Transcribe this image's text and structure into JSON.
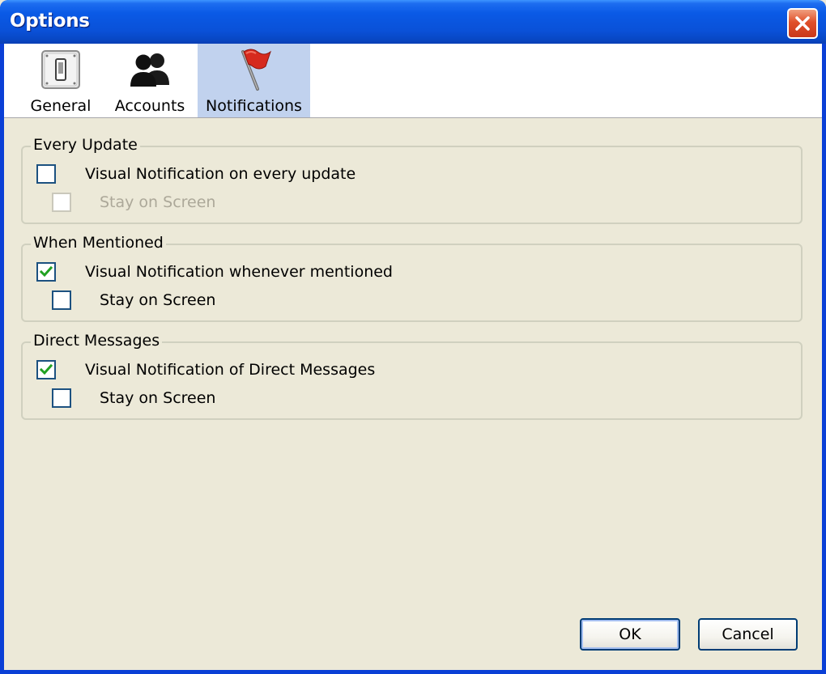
{
  "window": {
    "title": "Options",
    "close_icon": "close-icon"
  },
  "toolbar": {
    "tabs": [
      {
        "label": "General",
        "icon": "switch-icon",
        "selected": false
      },
      {
        "label": "Accounts",
        "icon": "users-icon",
        "selected": false
      },
      {
        "label": "Notifications",
        "icon": "flag-icon",
        "selected": true
      }
    ]
  },
  "groups": [
    {
      "title": "Every Update",
      "main": {
        "label": "Visual Notification on every update",
        "checked": false
      },
      "sub": {
        "label": "Stay on Screen",
        "checked": false,
        "enabled": false
      }
    },
    {
      "title": "When Mentioned",
      "main": {
        "label": "Visual Notification whenever mentioned",
        "checked": true
      },
      "sub": {
        "label": "Stay on Screen",
        "checked": false,
        "enabled": true
      }
    },
    {
      "title": "Direct Messages",
      "main": {
        "label": "Visual Notification of Direct Messages",
        "checked": true
      },
      "sub": {
        "label": "Stay on Screen",
        "checked": false,
        "enabled": true
      }
    }
  ],
  "buttons": {
    "ok_label": "OK",
    "cancel_label": "Cancel"
  },
  "colors": {
    "title_bar": "#0a51d8",
    "dialog_bg": "#ece9d8",
    "selected_tab": "#c1d2ee",
    "checkmark": "#21a121"
  }
}
